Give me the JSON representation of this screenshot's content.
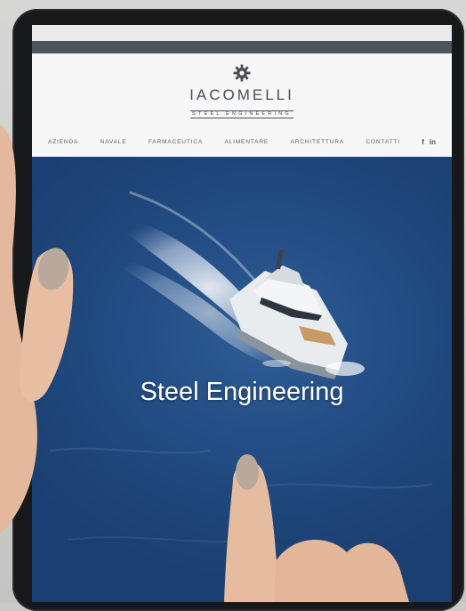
{
  "brand": {
    "name": "IACOMELLI",
    "tagline": "STEEL ENGINEERING"
  },
  "nav": {
    "items": [
      {
        "label": "AZIENDA"
      },
      {
        "label": "NAVALE"
      },
      {
        "label": "FARMACEUTICA"
      },
      {
        "label": "ALIMENTARE"
      },
      {
        "label": "ARCHITETTURA"
      },
      {
        "label": "CONTATTI"
      }
    ],
    "social": {
      "facebook": "f",
      "linkedin": "in"
    }
  },
  "hero": {
    "title": "Steel Engineering"
  },
  "colors": {
    "topbar": "#4a5660",
    "sea": "#234d84",
    "header_bg": "#f7f7f7",
    "tablet_frame": "#161819"
  },
  "icons": [
    "gear-icon",
    "facebook-icon",
    "linkedin-icon"
  ]
}
